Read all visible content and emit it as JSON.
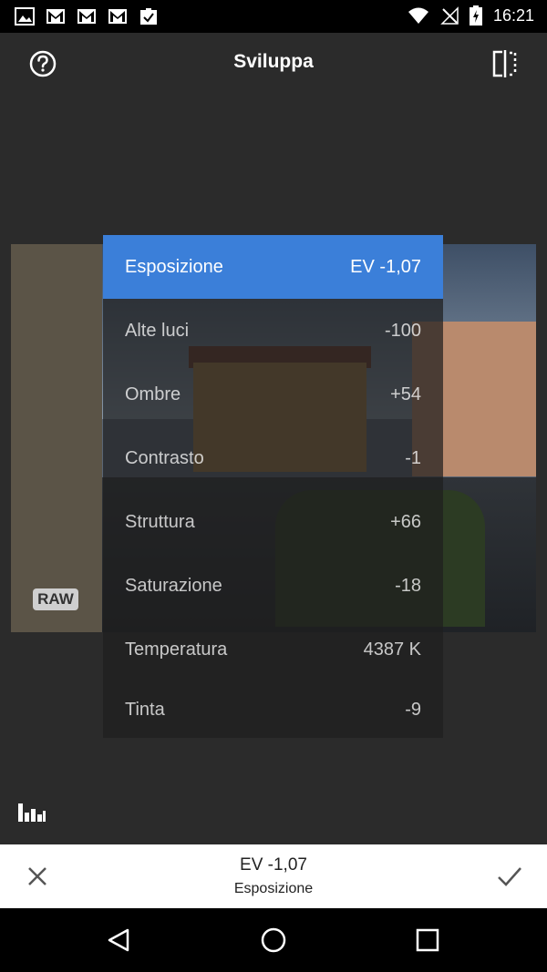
{
  "status_bar": {
    "time": "16:21",
    "left_icons": [
      "image-icon",
      "gmail-icon",
      "gmail-icon",
      "gmail-icon",
      "clipboard-check-icon"
    ],
    "right_icons": [
      "wifi-icon",
      "no-signal-icon",
      "battery-charging-icon"
    ]
  },
  "top_bar": {
    "title": "Sviluppa",
    "help_icon": "help-circle-icon",
    "compare_icon": "compare-split-icon"
  },
  "photo": {
    "badge": "RAW"
  },
  "menu": {
    "items": [
      {
        "label": "Esposizione",
        "value": "EV -1,07",
        "active": true
      },
      {
        "label": "Alte luci",
        "value": "-100"
      },
      {
        "label": "Ombre",
        "value": "+54"
      },
      {
        "label": "Contrasto",
        "value": "-1"
      },
      {
        "label": "Struttura",
        "value": "+66"
      },
      {
        "label": "Saturazione",
        "value": "-18"
      },
      {
        "label": "Temperatura",
        "value": "4387 K"
      },
      {
        "label": "Tinta",
        "value": "-9"
      }
    ]
  },
  "histogram_icon": "histogram-icon",
  "bottom_bar": {
    "value": "EV -1,07",
    "parameter": "Esposizione",
    "cancel_icon": "close-icon",
    "confirm_icon": "check-icon"
  },
  "nav_bar": {
    "icons": [
      "back-triangle-icon",
      "home-circle-icon",
      "recents-square-icon"
    ]
  },
  "colors": {
    "accent": "#3b7fd9",
    "background": "#2b2b2b"
  }
}
